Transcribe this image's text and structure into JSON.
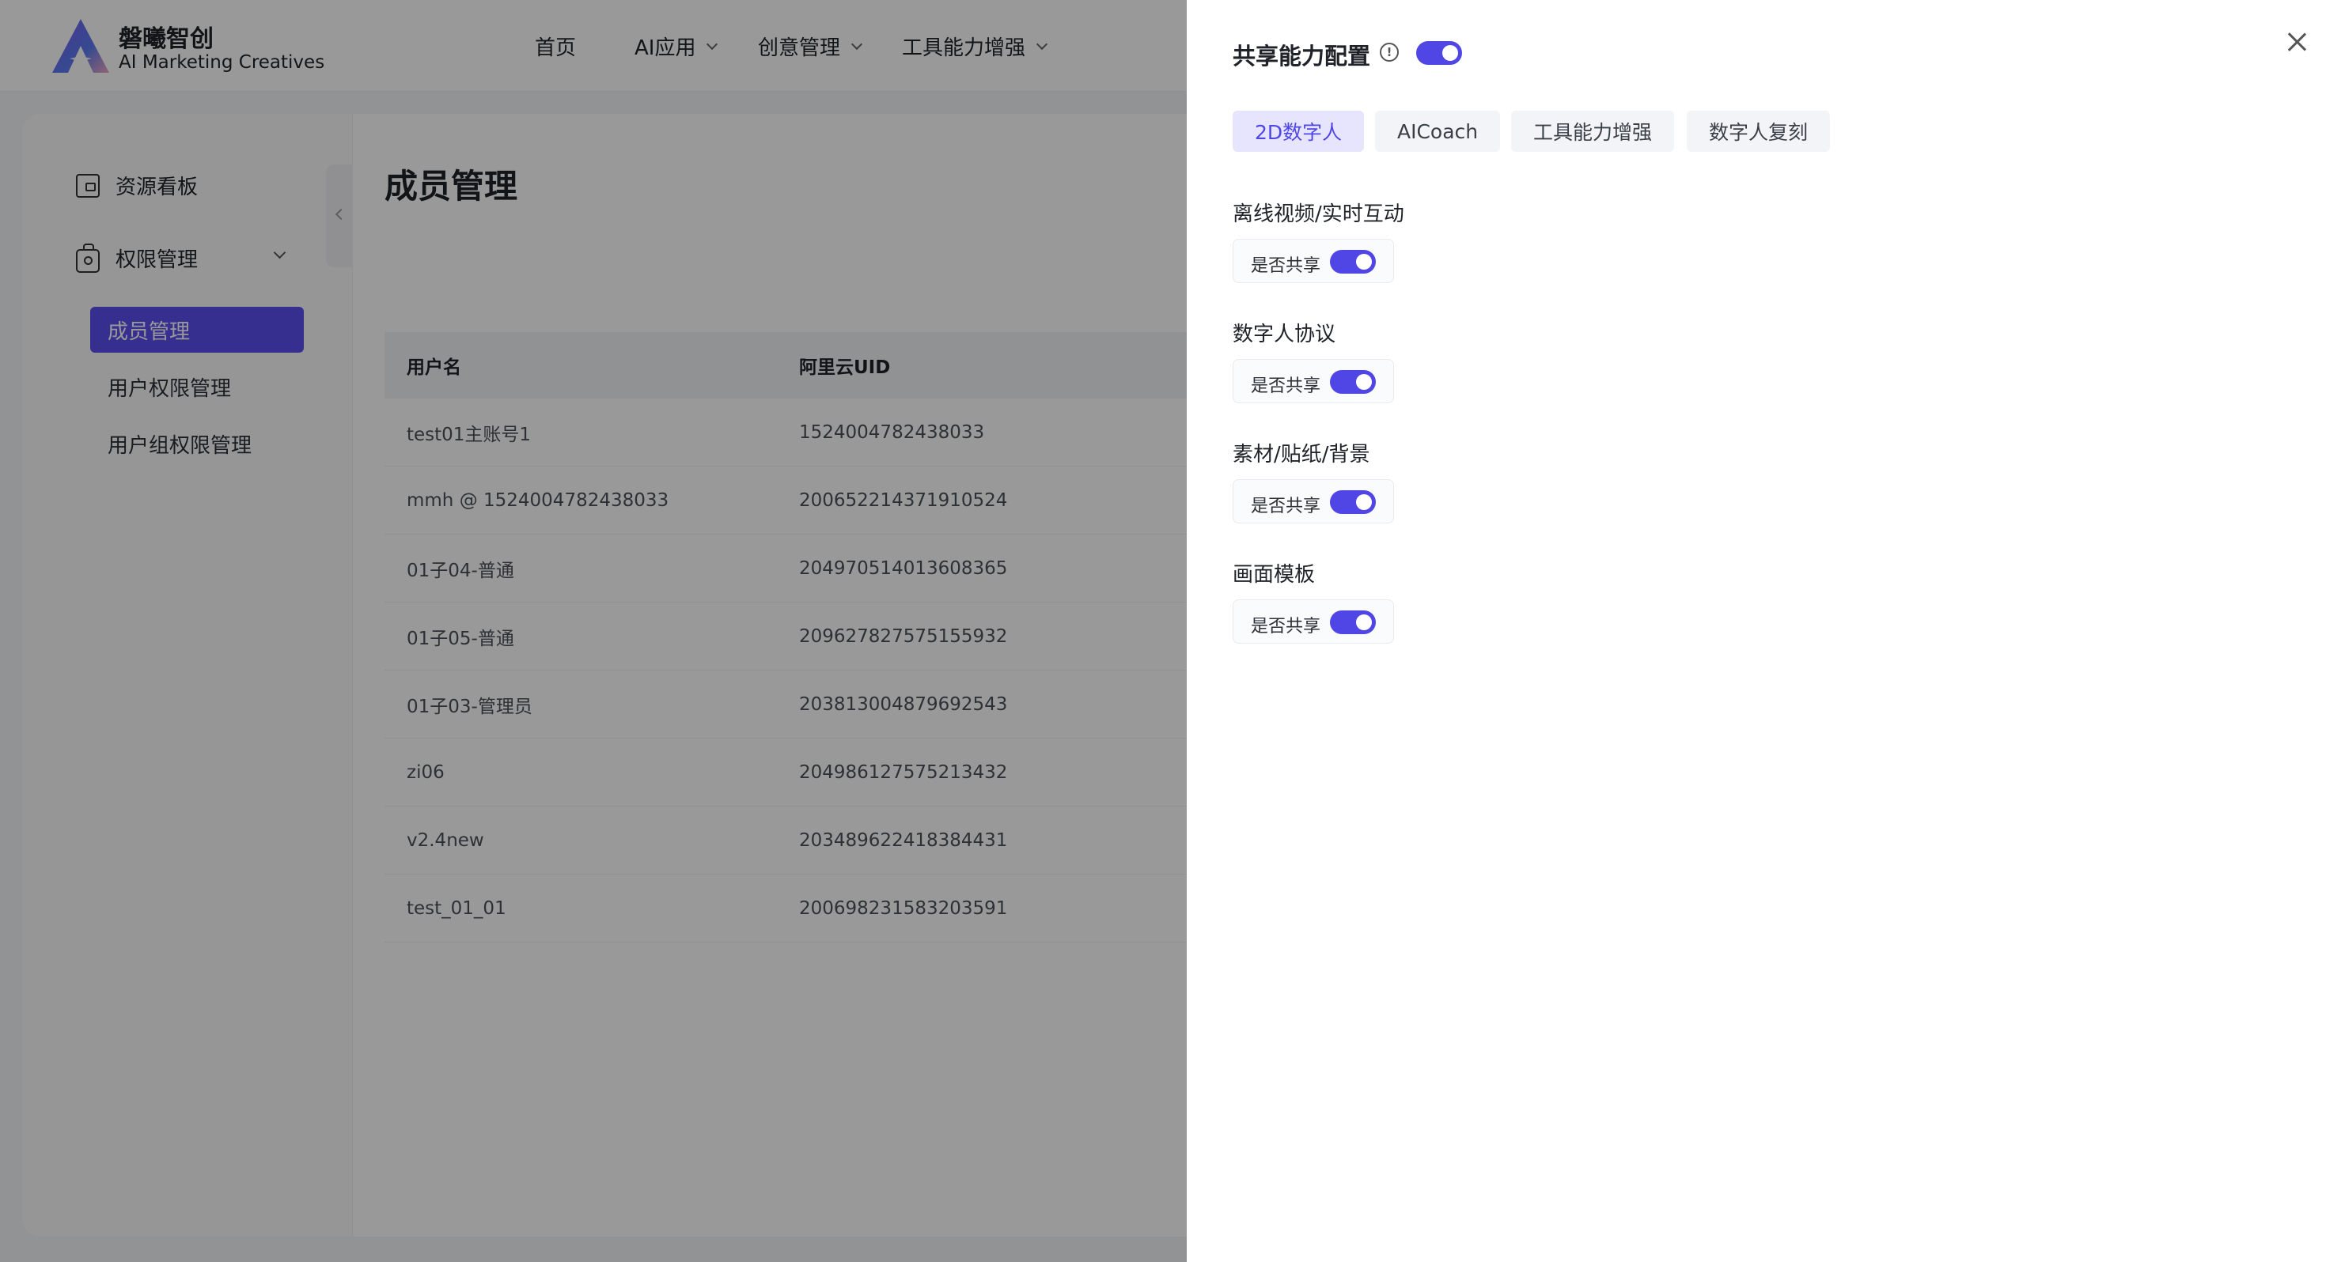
{
  "brand": {
    "name_cn": "磐曦智创",
    "name_en": "AI Marketing Creatives"
  },
  "nav": [
    {
      "label": "首页",
      "has_dropdown": false
    },
    {
      "label": "AI应用",
      "has_dropdown": true
    },
    {
      "label": "创意管理",
      "has_dropdown": true
    },
    {
      "label": "工具能力增强",
      "has_dropdown": true
    }
  ],
  "sidebar": {
    "items": [
      {
        "label": "资源看板",
        "icon": "wallet-icon"
      },
      {
        "label": "权限管理",
        "icon": "bag-icon",
        "expanded": true
      }
    ],
    "sub_items": [
      {
        "label": "成员管理",
        "active": true
      },
      {
        "label": "用户权限管理",
        "active": false
      },
      {
        "label": "用户组权限管理",
        "active": false
      }
    ]
  },
  "main": {
    "title": "成员管理",
    "table": {
      "headers": [
        "用户名",
        "阿里云UID"
      ],
      "rows": [
        [
          "test01主账号1",
          "1524004782438033"
        ],
        [
          "mmh @ 1524004782438033",
          "200652214371910524"
        ],
        [
          "01子04-普通",
          "204970514013608365"
        ],
        [
          "01子05-普通",
          "209627827575155932"
        ],
        [
          "01子03-管理员",
          "203813004879692543"
        ],
        [
          "zi06",
          "204986127575213432"
        ],
        [
          "v2.4new",
          "203489622418384431"
        ],
        [
          "test_01_01",
          "200698231583203591"
        ]
      ]
    }
  },
  "drawer": {
    "title": "共享能力配置",
    "master_toggle_on": true,
    "tabs": [
      "2D数字人",
      "AICoach",
      "工具能力增强",
      "数字人复刻"
    ],
    "active_tab": 0,
    "sections": [
      {
        "label": "离线视频/实时互动",
        "share_label": "是否共享",
        "on": true
      },
      {
        "label": "数字人协议",
        "share_label": "是否共享",
        "on": true
      },
      {
        "label": "素材/贴纸/背景",
        "share_label": "是否共享",
        "on": true
      },
      {
        "label": "画面模板",
        "share_label": "是否共享",
        "on": true
      }
    ]
  },
  "colors": {
    "accent": "#4f46e5",
    "active_menu": "#5b4ff0",
    "mask": "rgba(0,0,0,0.40)"
  }
}
